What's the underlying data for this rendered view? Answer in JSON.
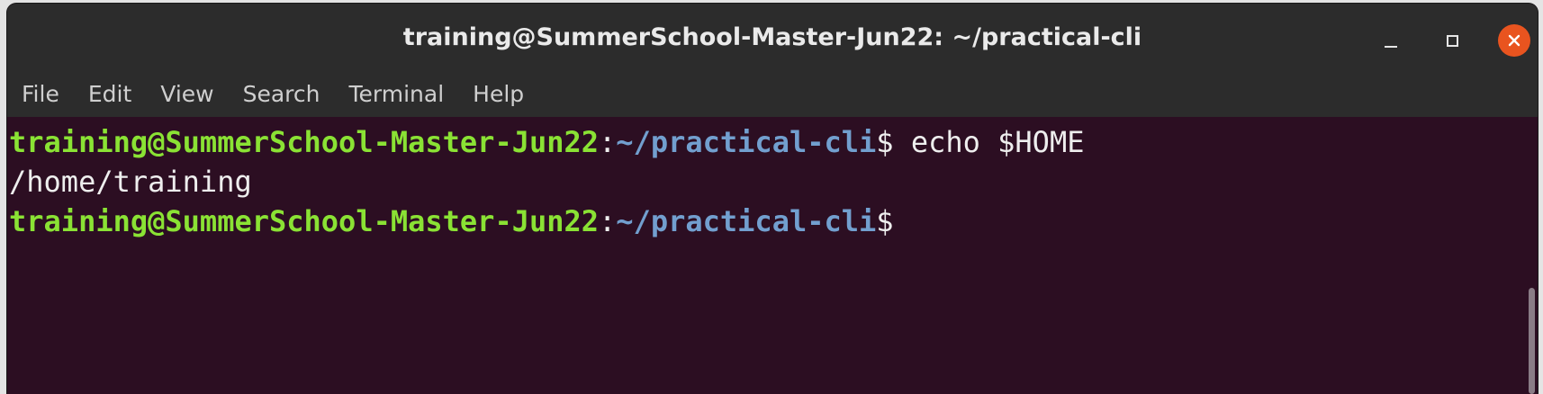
{
  "window": {
    "title": "training@SummerSchool-Master-Jun22: ~/practical-cli",
    "controls": {
      "minimize_icon": "minimize-icon",
      "maximize_icon": "maximize-icon",
      "close_icon": "close-icon",
      "close_glyph": "✕"
    }
  },
  "menubar": {
    "items": [
      {
        "label": "File"
      },
      {
        "label": "Edit"
      },
      {
        "label": "View"
      },
      {
        "label": "Search"
      },
      {
        "label": "Terminal"
      },
      {
        "label": "Help"
      }
    ]
  },
  "terminal": {
    "lines": [
      {
        "user_host": "training@SummerSchool-Master-Jun22",
        "colon": ":",
        "cwd": "~/practical-cli",
        "prompt": "$",
        "command": " echo $HOME"
      },
      {
        "output": "/home/training"
      },
      {
        "user_host": "training@SummerSchool-Master-Jun22",
        "colon": ":",
        "cwd": "~/practical-cli",
        "prompt": "$",
        "command": ""
      }
    ]
  },
  "colors": {
    "terminal_background": "#2c0e22",
    "titlebar_background": "#2c2c2c",
    "user_host": "#8ae234",
    "cwd": "#729fcf",
    "close_button": "#e9541f"
  }
}
